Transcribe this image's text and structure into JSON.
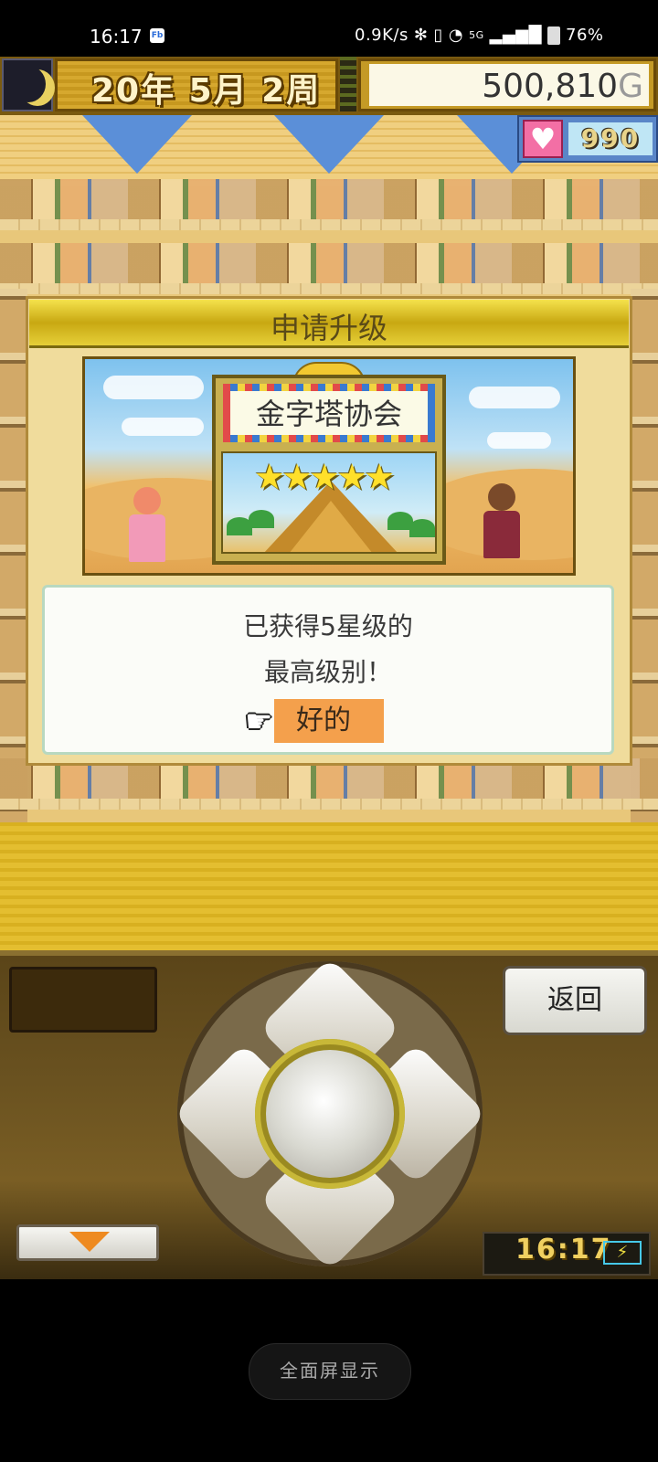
{
  "status_bar": {
    "time": "16:17",
    "app_icon_text": "Fb",
    "right_text": "0.9K/s",
    "network": "5G",
    "battery": "76%"
  },
  "hud": {
    "date": "20年 5月 2周",
    "money_value": "500,810",
    "money_unit": "G",
    "hearts": "990",
    "moon_icon": "crescent-moon-icon",
    "heart_icon": "heart-icon"
  },
  "dialog": {
    "title": "申请升级",
    "plaque_title": "金字塔协会",
    "stars": "★★★★★",
    "star_count": 5,
    "message_line1": "已获得5星级的",
    "message_line2": "最高级别！",
    "ok_label": "好的",
    "pointer_icon": "pointing-hand-icon"
  },
  "controller": {
    "back_label": "返回",
    "clock": "16:17",
    "down_icon": "down-arrow-icon",
    "battery_icon": "charging-battery-icon"
  },
  "system": {
    "fullscreen_label": "全面屏显示"
  },
  "colors": {
    "ok_highlight": "#f4a04c",
    "title_bar": "#e6cf38",
    "sand": "#e4be30"
  }
}
